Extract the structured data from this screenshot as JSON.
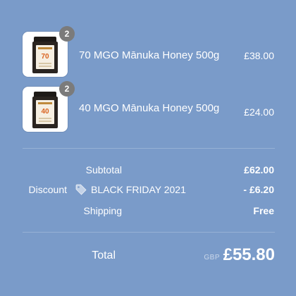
{
  "cart_items": [
    {
      "name": "70 MGO Mānuka Honey 500g",
      "price": "£38.00",
      "quantity": "2",
      "jar_grade": "70"
    },
    {
      "name": "40 MGO Mānuka Honey 500g",
      "price": "£24.00",
      "quantity": "2",
      "jar_grade": "40"
    }
  ],
  "summary": {
    "subtotal_label": "Subtotal",
    "subtotal_value": "£62.00",
    "discount_label": "Discount",
    "discount_code": "BLACK FRIDAY 2021",
    "discount_value": "- £6.20",
    "shipping_label": "Shipping",
    "shipping_value": "Free"
  },
  "total": {
    "label": "Total",
    "currency": "GBP",
    "value": "£55.80"
  },
  "colors": {
    "background": "#7a9bc9",
    "text": "#ffffff",
    "badge": "#7b7b7b",
    "jar": "#2a2420",
    "jar_grade": "#d9621f"
  },
  "icons": {
    "discount": "tag-icon"
  }
}
